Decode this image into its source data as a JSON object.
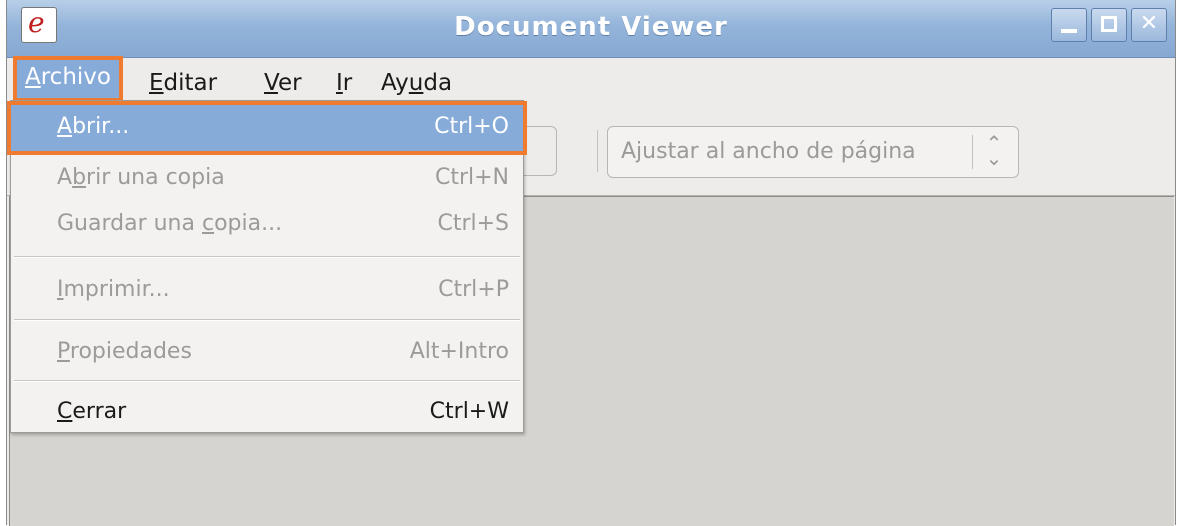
{
  "window": {
    "title": "Document Viewer",
    "app_icon_glyph": "e",
    "buttons": [
      "minimize-icon",
      "maximize-icon",
      "close-icon"
    ]
  },
  "menubar": {
    "items": [
      {
        "pre": "",
        "u": "A",
        "post": "rchivo"
      },
      {
        "pre": "",
        "u": "E",
        "post": "ditar"
      },
      {
        "pre": "",
        "u": "V",
        "post": "er"
      },
      {
        "pre": "",
        "u": "I",
        "post": "r"
      },
      {
        "pre": "Ay",
        "u": "u",
        "post": "da"
      }
    ]
  },
  "toolbar": {
    "zoom_value": "Ajustar al ancho de página",
    "zoom_arrow_icon": "updown-arrows-icon"
  },
  "file_menu": {
    "items": [
      {
        "pre": "",
        "u": "A",
        "post": "brir...",
        "accel": "Ctrl+O",
        "enabled": true,
        "highlighted": true
      },
      {
        "pre": "A",
        "u": "b",
        "post": "rir una copia",
        "accel": "Ctrl+N",
        "enabled": false
      },
      {
        "pre": "Guardar una ",
        "u": "c",
        "post": "opia...",
        "accel": "Ctrl+S",
        "enabled": false
      },
      {
        "pre": "",
        "u": "I",
        "post": "mprimir...",
        "accel": "Ctrl+P",
        "enabled": false
      },
      {
        "pre": "",
        "u": "P",
        "post": "ropiedades",
        "accel": "Alt+Intro",
        "enabled": false
      },
      {
        "pre": "",
        "u": "C",
        "post": "errar",
        "accel": "Ctrl+W",
        "enabled": true
      }
    ]
  },
  "colors": {
    "highlight": "#86abd9",
    "annotation_outline": "#f07a2e",
    "titlebar": "#94b4da"
  }
}
